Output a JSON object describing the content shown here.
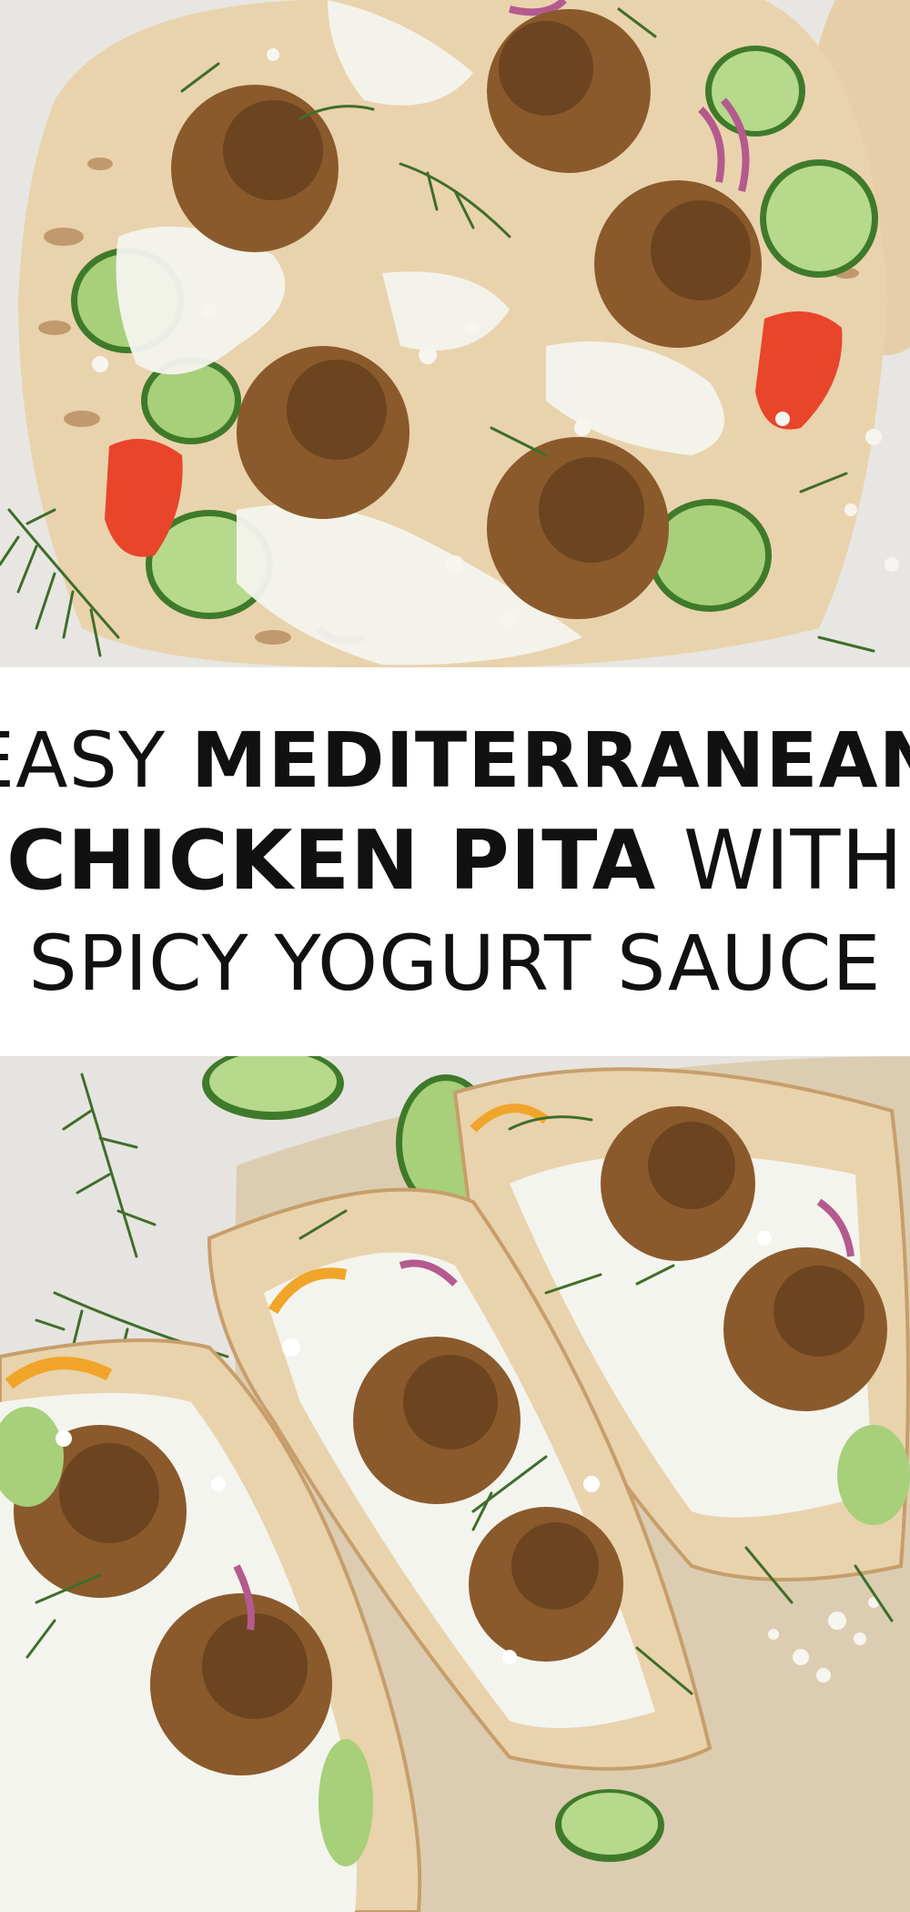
{
  "title": {
    "line1": {
      "light": "EASY",
      "bold": "MEDITERRANEAN"
    },
    "line2": {
      "bold": "CHICKEN PITA",
      "light": "WITH"
    },
    "line3": {
      "light": "SPICY YOGURT SAUCE"
    }
  },
  "colors": {
    "banner_bg": "#ffffff",
    "title_text": "#111111",
    "countertop": "#e8e6e2",
    "pita": "#e9d3ad",
    "pita_char": "#a06a3a",
    "meatball": "#8a5a2c",
    "meatball_dark": "#4a2a12",
    "yogurt_sauce": "#f4f4ee",
    "cucumber": "#a8cf7a",
    "cucumber_skin": "#3f7a2a",
    "tomato": "#e8452a",
    "red_onion": "#b45a8e",
    "dill": "#3f6e2a",
    "feta": "#f7f5ef",
    "parchment": "#d9c7a6"
  }
}
